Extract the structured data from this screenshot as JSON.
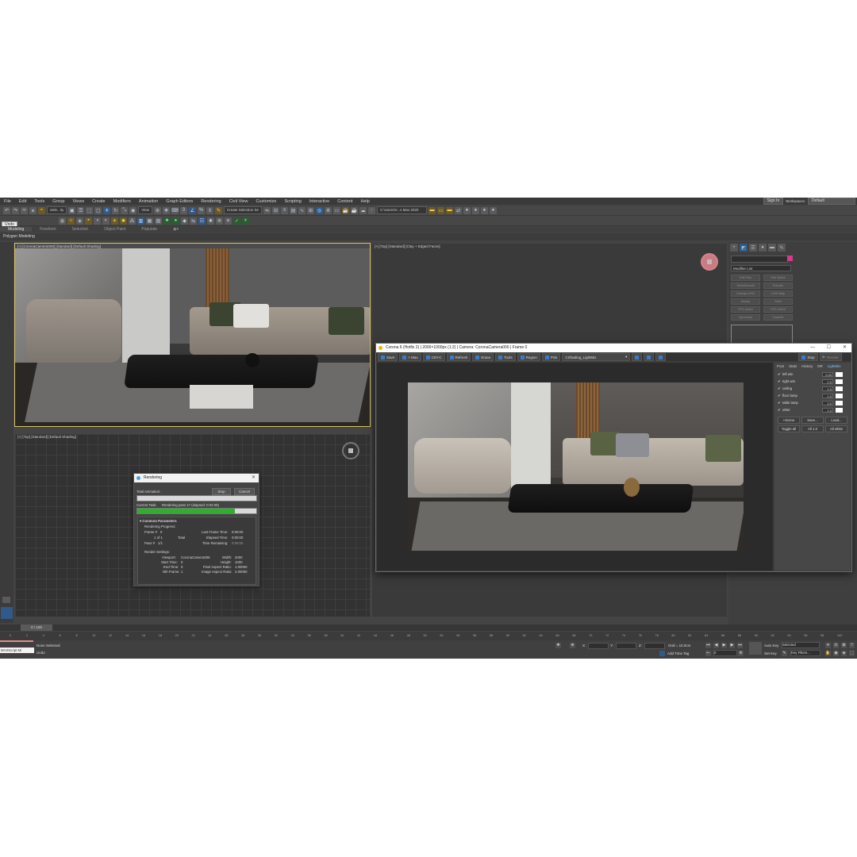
{
  "menu": [
    "File",
    "Edit",
    "Tools",
    "Group",
    "Views",
    "Create",
    "Modifiers",
    "Animation",
    "Graph Editors",
    "Rendering",
    "Civil View",
    "Customize",
    "Scripting",
    "Interactive",
    "Content",
    "Help"
  ],
  "account": {
    "sign_in": "Sign In",
    "workspaces_label": "Workspaces:",
    "workspace": "Default"
  },
  "toolbar": {
    "selection_filter": "Sele...ity",
    "view": "View",
    "create_selection_set": "Create Selection Se",
    "path": "C:\\Users\\V...s Max 2020"
  },
  "undo_tooltip": "Undo",
  "ribbon": {
    "tabs": [
      "Modeling",
      "Freeform",
      "Selection",
      "Object Paint",
      "Populate"
    ],
    "sub": "Polygon Modeling"
  },
  "viewports": {
    "camera": "[+] [CoronaCamera006] [Standard] [Default Shading]",
    "top": "[+] [Top] [Standard] [Clay + Edged Faces]",
    "top2": "[+] [Top] [Standard] [Default Shading]"
  },
  "command_panel": {
    "modifier_list": "Modifier List",
    "buttons": [
      "Edit Poly",
      "Edit Spline",
      "TurboSmooth",
      "Extrude",
      "Unwrap UVW",
      "UVW Map",
      "Sweep",
      "Shell",
      "FFD 4x4x4",
      "FFD 3x3x3",
      "Symmetry",
      "Chamfer"
    ]
  },
  "rendering_dialog": {
    "title": "Rendering",
    "stop": "Stop",
    "cancel": "Cancel",
    "total_animation": "Total Animation:",
    "current_task_label": "Current Task:",
    "current_task": "Rendering pass 17 (elapsed: 0:04:09)",
    "progress": 0.82,
    "section": "Common Parameters",
    "rendering_progress": "Rendering Progress:",
    "frame_label": "Frame #",
    "frame": "0",
    "of": "1 of 1",
    "total": "Total",
    "pass_label": "Pass #",
    "pass": "1/1",
    "last_frame": "Last Frame Time:",
    "last_frame_v": "0:00:00",
    "elapsed": "Elapsed Time:",
    "elapsed_v": "0:00:00",
    "remaining": "Time Remaining:",
    "remaining_v": "0:00:00",
    "render_settings": "Render Settings:",
    "viewport_label": "Viewport:",
    "viewport": "CoronaCamera006",
    "width_label": "Width:",
    "width": "2000",
    "start_label": "Start Time:",
    "start": "0",
    "height_label": "Height:",
    "height": "1000",
    "end_label": "End Time:",
    "end": "0",
    "pixel_aspect_label": "Pixel Aspect Ratio:",
    "pixel_aspect": "1.00000",
    "nth_label": "Nth Frame:",
    "nth": "1",
    "image_aspect_label": "Image Aspect Ratio:",
    "image_aspect": "2.00000"
  },
  "vfb": {
    "title": "Corona 6 (Hotfix 2) | 2000×1000px (1:2) | Camera: CoronaCamera006 | Frame 0",
    "tools": [
      "Save",
      "> Max",
      "Ctrl+C",
      "Refresh",
      "Erase",
      "Tools",
      "Region",
      "Pick"
    ],
    "element": "CShading_LightMix",
    "stop": "Stop",
    "render": "Render",
    "tabs": [
      "Post",
      "Stats",
      "History",
      "DR",
      "LightMix"
    ],
    "lights": [
      {
        "name": "left win",
        "value": "0.20"
      },
      {
        "name": "right win",
        "value": "1.0"
      },
      {
        "name": "ceiling",
        "value": "1.0"
      },
      {
        "name": "floor lamp",
        "value": "1.0"
      },
      {
        "name": "table lamp",
        "value": "2.0"
      },
      {
        "name": "other",
        "value": "1.0"
      }
    ],
    "scene_btn": "+Scene",
    "save_btn": "Save...",
    "load_btn": "Load...",
    "toggle_all": "Toggle all",
    "all_10": "All 1.0",
    "all_white": "All white"
  },
  "timeline": {
    "slider": "0 / 100",
    "ticks": [
      "0",
      "2",
      "4",
      "6",
      "8",
      "10",
      "12",
      "14",
      "16",
      "18",
      "20",
      "22",
      "24",
      "26",
      "28",
      "30",
      "32",
      "34",
      "36",
      "38",
      "40",
      "42",
      "44",
      "46",
      "48",
      "50",
      "52",
      "54",
      "56",
      "58",
      "60",
      "62",
      "64",
      "66",
      "68",
      "70",
      "72",
      "74",
      "76",
      "78",
      "80",
      "82",
      "84",
      "86",
      "88",
      "90",
      "92",
      "94",
      "96",
      "98",
      "100"
    ]
  },
  "status": {
    "maxscript": "MAXScript Mi",
    "none_selected": "None Selected",
    "undo": "Undo",
    "x": "X:",
    "y": "Y:",
    "z": "Z:",
    "grid": "Grid = 10.0cm",
    "add_time_tag": "Add Time Tag",
    "auto_key": "Auto Key",
    "selected": "Selected",
    "set_key": "Set Key",
    "key_filters": "Key Filters...",
    "frame": "0"
  },
  "colors": {
    "accent_blue": "#2f5a8a",
    "progress_green": "#2fae2f",
    "active_border": "#d8c56a",
    "color_swatch": "#d63b8a"
  }
}
